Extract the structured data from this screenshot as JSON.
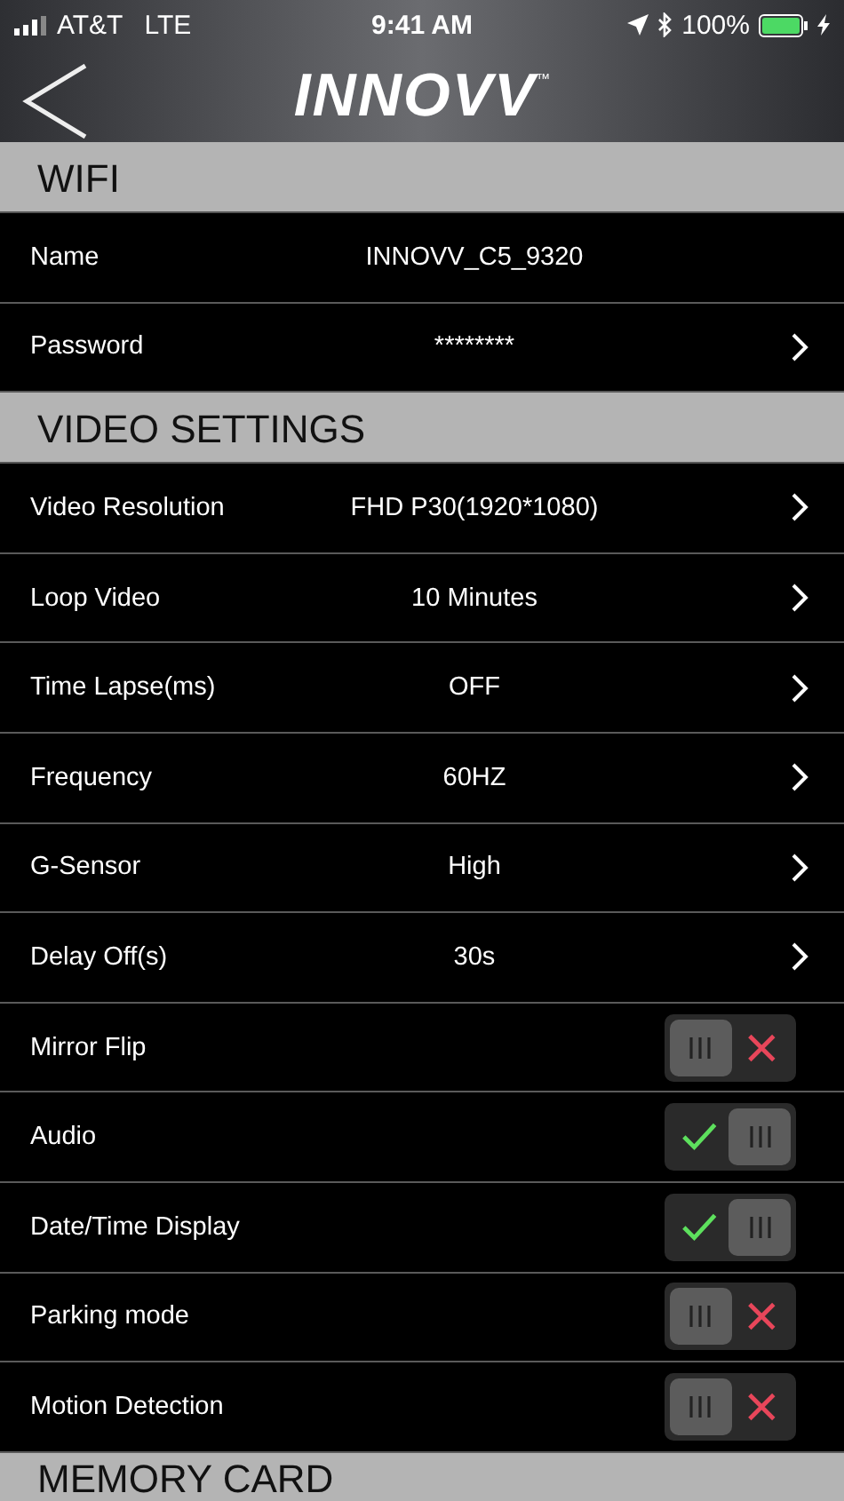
{
  "status_bar": {
    "carrier": "AT&T",
    "network": "LTE",
    "time": "9:41 AM",
    "battery": "100%"
  },
  "nav": {
    "logo": "INNOVV",
    "logo_mark": "™"
  },
  "sections": [
    {
      "title": "WIFI",
      "rows": [
        {
          "kind": "info",
          "label": "Name",
          "value": "INNOVV_C5_9320"
        },
        {
          "kind": "select",
          "label": "Password",
          "value": "********"
        }
      ]
    },
    {
      "title": "VIDEO SETTINGS",
      "rows": [
        {
          "kind": "select",
          "label": "Video Resolution",
          "value": "FHD P30(1920*1080)"
        },
        {
          "kind": "select",
          "label": "Loop Video",
          "value": "10 Minutes"
        },
        {
          "kind": "select",
          "label": "Time Lapse(ms)",
          "value": "OFF"
        },
        {
          "kind": "select",
          "label": "Frequency",
          "value": "60HZ"
        },
        {
          "kind": "select",
          "label": "G-Sensor",
          "value": "High"
        },
        {
          "kind": "select",
          "label": "Delay Off(s)",
          "value": "30s"
        },
        {
          "kind": "toggle",
          "label": "Mirror Flip",
          "on": false
        },
        {
          "kind": "toggle",
          "label": "Audio",
          "on": true
        },
        {
          "kind": "toggle",
          "label": "Date/Time Display",
          "on": true
        },
        {
          "kind": "toggle",
          "label": "Parking mode",
          "on": false
        },
        {
          "kind": "toggle",
          "label": "Motion Detection",
          "on": false
        }
      ]
    },
    {
      "title": "MEMORY CARD"
    }
  ]
}
